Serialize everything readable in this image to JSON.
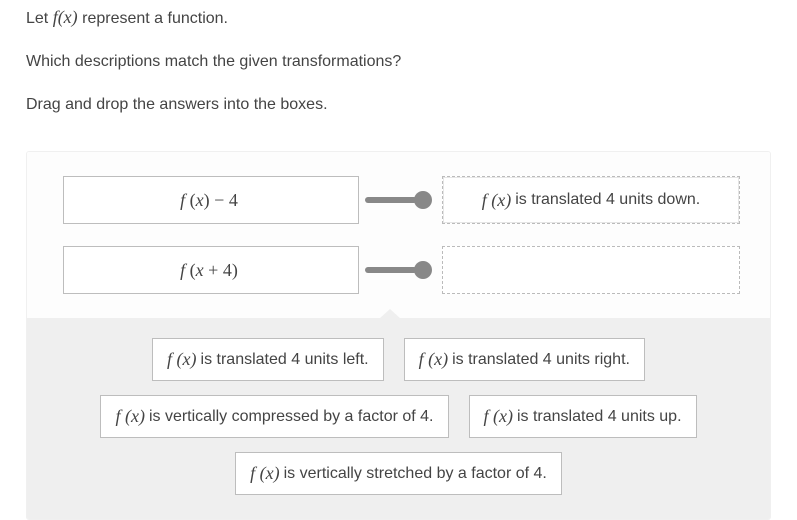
{
  "instructions": {
    "line1_pre": "Let ",
    "line1_math": "f(x)",
    "line1_post": " represent a function.",
    "line2": "Which descriptions match the given transformations?",
    "line3": "Drag and drop the answers into the boxes."
  },
  "prompts": [
    {
      "expr": "f (x) − 4"
    },
    {
      "expr": "f (x + 4)"
    }
  ],
  "drops": [
    {
      "filled": true,
      "math": "f (x)",
      "text": " is translated 4 units down."
    },
    {
      "filled": false,
      "math": "",
      "text": ""
    }
  ],
  "bank": {
    "row1": [
      {
        "math": "f (x)",
        "text": " is translated 4 units left."
      },
      {
        "math": "f (x)",
        "text": " is translated 4 units right."
      }
    ],
    "row2": [
      {
        "math": "f (x)",
        "text": " is vertically compressed by a factor of 4."
      },
      {
        "math": "f (x)",
        "text": " is translated 4 units up."
      }
    ],
    "row3": [
      {
        "math": "f (x) ",
        "text": " is vertically stretched by a factor of 4."
      }
    ]
  }
}
